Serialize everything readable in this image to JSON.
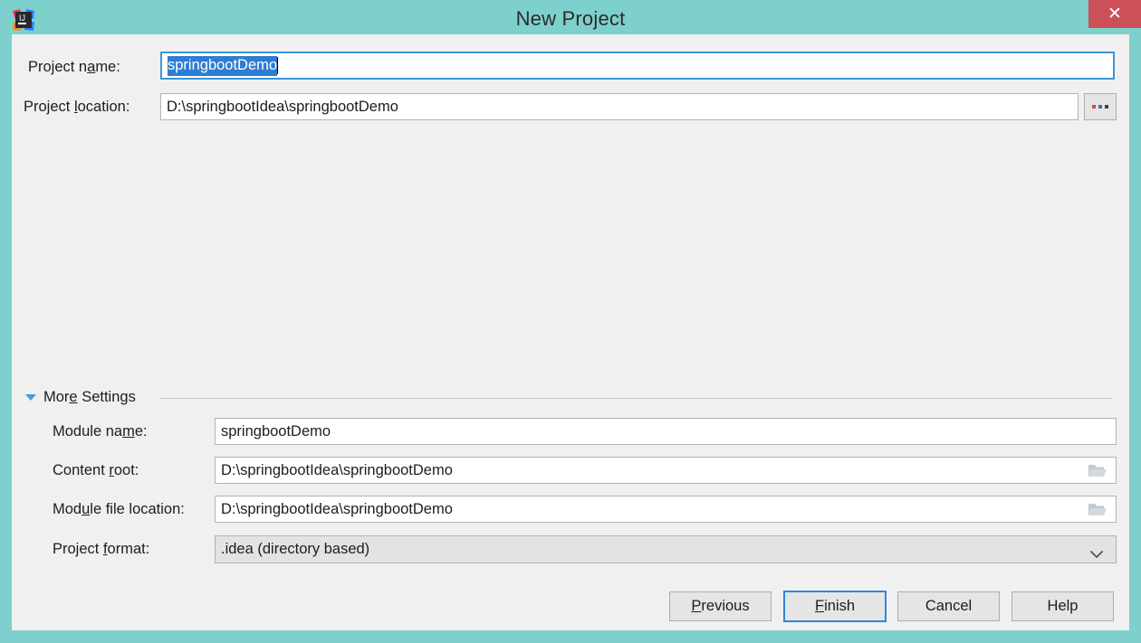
{
  "window": {
    "title": "New Project",
    "app_icon": "intellij-idea-icon",
    "close_icon": "close-icon",
    "frame_color": "#7ed0cd",
    "close_button_color": "#cb5058",
    "body_background": "#f0f0f0"
  },
  "form": {
    "project_name": {
      "label_before": "Project n",
      "label_mnemonic": "a",
      "label_after": "me:",
      "value": "springbootDemo",
      "selected": true,
      "selection_color": "#2f7dd1",
      "focused": true
    },
    "project_location": {
      "label_before": "Project ",
      "label_mnemonic": "l",
      "label_after": "ocation:",
      "value": "D:\\springbootIdea\\springbootDemo",
      "browse_button_label": "...",
      "browse_icon": "ellipsis-icon"
    }
  },
  "more_settings": {
    "label_before": "Mor",
    "label_mnemonic": "e",
    "label_after": " Settings",
    "expanded": true,
    "toggle_icon": "triangle-down-icon",
    "accent_color": "#4a9ad4",
    "fields": {
      "module_name": {
        "label_before": "Module na",
        "label_mnemonic": "m",
        "label_after": "e:",
        "value": "springbootDemo"
      },
      "content_root": {
        "label_before": "Content ",
        "label_mnemonic": "r",
        "label_after": "oot:",
        "value": "D:\\springbootIdea\\springbootDemo",
        "browse_icon": "folder-icon"
      },
      "module_file_location": {
        "label_before": "Mod",
        "label_mnemonic": "u",
        "label_after": "le file location:",
        "value": "D:\\springbootIdea\\springbootDemo",
        "browse_icon": "folder-icon"
      },
      "project_format": {
        "label_before": "Project ",
        "label_mnemonic": "f",
        "label_after": "ormat:",
        "value": ".idea (directory based)",
        "dropdown_icon": "chevron-down-icon",
        "options": [
          ".idea (directory based)"
        ]
      }
    }
  },
  "buttons": {
    "previous": {
      "before": "",
      "mnemonic": "P",
      "after": "revious"
    },
    "finish": {
      "before": "",
      "mnemonic": "F",
      "after": "inish",
      "is_default": true,
      "focus_color": "#2e87d8"
    },
    "cancel": {
      "before": "Cancel",
      "mnemonic": "",
      "after": ""
    },
    "help": {
      "before": "Help",
      "mnemonic": "",
      "after": ""
    }
  }
}
